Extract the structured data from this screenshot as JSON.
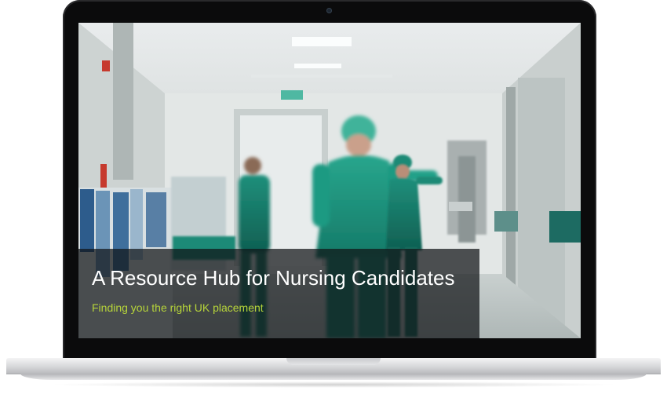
{
  "hero": {
    "headline": "A Resource Hub for Nursing Candidates",
    "subheadline": "Finding you the right UK placement"
  },
  "colors": {
    "subheadline": "#b6d43a",
    "scrubs": "#1f9a84",
    "caption_background": "#101416"
  }
}
